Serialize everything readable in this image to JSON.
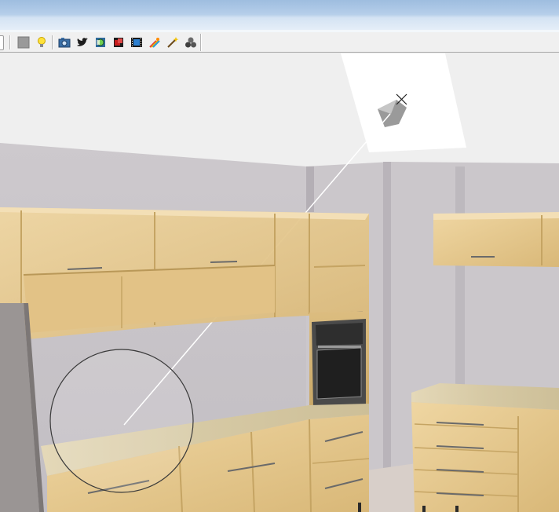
{
  "window": {
    "title": ""
  },
  "toolbar": {
    "buttons": [
      {
        "name": "color-swatch-button",
        "icon": "gray-square-icon"
      },
      {
        "name": "light-button",
        "icon": "lightbulb-icon"
      },
      {
        "name": "camera-button",
        "icon": "camera-icon"
      },
      {
        "name": "twitter-button",
        "icon": "twitter-bird-icon"
      },
      {
        "name": "export-button",
        "icon": "globe-export-icon"
      },
      {
        "name": "render-button",
        "icon": "red-box-icon"
      },
      {
        "name": "film-button",
        "icon": "film-strip-icon"
      },
      {
        "name": "effects-button",
        "icon": "rainbow-brush-icon"
      },
      {
        "name": "magic-wand-button",
        "icon": "magic-wand-icon"
      },
      {
        "name": "materials-button",
        "icon": "spheres-icon"
      }
    ]
  },
  "scene": {
    "description_colors": {
      "wall": "#c8c4c8",
      "ceiling": "#efefef",
      "cabinet_wood": "#e6c88e",
      "countertop": "#d9cfae",
      "light_plane": "#ffffff"
    }
  }
}
